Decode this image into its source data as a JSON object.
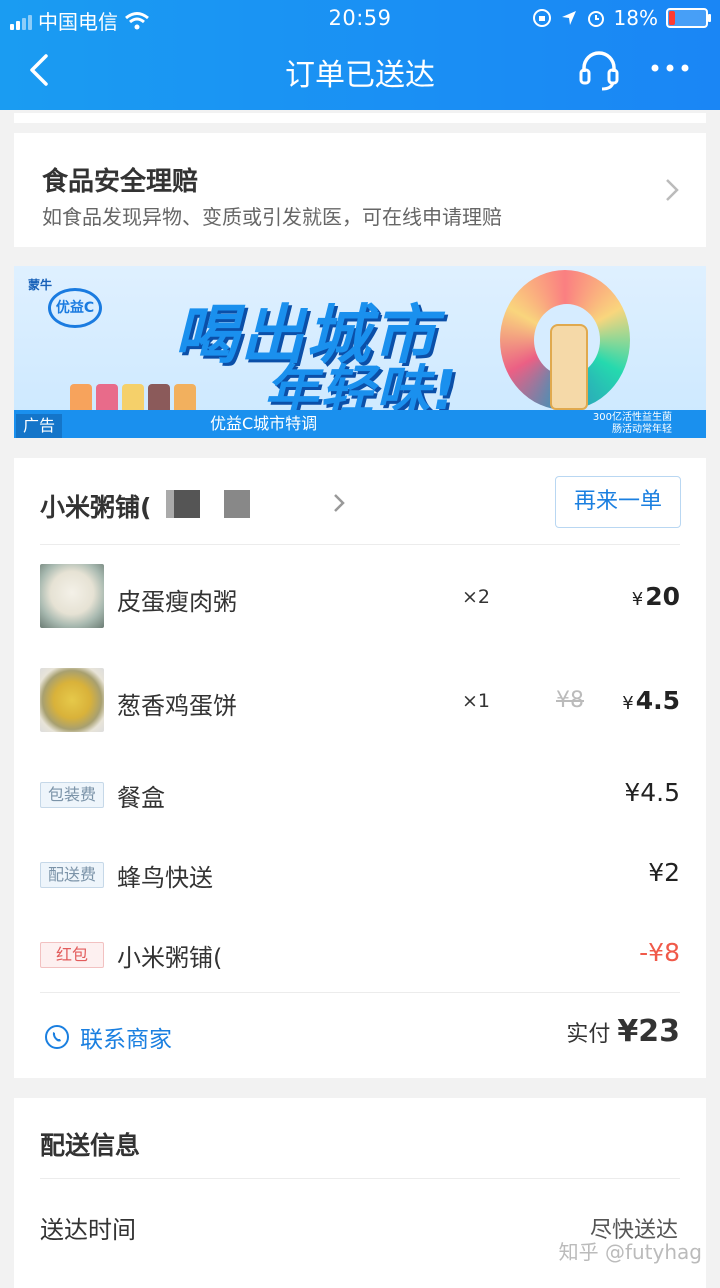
{
  "status_bar": {
    "carrier": "中国电信",
    "time": "20:59",
    "battery": "18%"
  },
  "nav": {
    "title": "订单已送达"
  },
  "claim": {
    "title": "食品安全理赔",
    "subtitle": "如食品发现异物、变质或引发就医，可在线申请理赔"
  },
  "ad": {
    "brand": "蒙牛",
    "logo_text": "优益C",
    "headline_1": "喝出城市",
    "headline_2": "年轻味!",
    "tag": "广告",
    "slogan": "优益C城市特调",
    "small_text_1": "300亿活性益生菌",
    "small_text_2": "肠活动常年轻"
  },
  "order": {
    "shop_name": "小米粥铺(",
    "reorder_label": "再来一单",
    "items": [
      {
        "name": "皮蛋瘦肉粥",
        "qty": "×2",
        "old_price": "",
        "price": "20"
      },
      {
        "name": "葱香鸡蛋饼",
        "qty": "×1",
        "old_price": "¥8",
        "price": "4.5"
      }
    ],
    "fees": [
      {
        "tag": "包装费",
        "name": "餐盒",
        "price": "¥4.5"
      },
      {
        "tag": "配送费",
        "name": "蜂鸟快送",
        "price": "¥2"
      },
      {
        "tag": "红包",
        "name": "小米粥铺(",
        "price": "-¥8"
      }
    ],
    "contact_label": "联系商家",
    "paid_label": "实付",
    "paid_currency": "¥",
    "paid_amount": "23"
  },
  "delivery": {
    "title": "配送信息",
    "time_label": "送达时间",
    "time_value": "尽快送达"
  },
  "watermark": "知乎 @futyhag",
  "colors": {
    "header": "#1a8ff2",
    "accent": "#1a7fe0",
    "discount": "#f05a4a"
  }
}
